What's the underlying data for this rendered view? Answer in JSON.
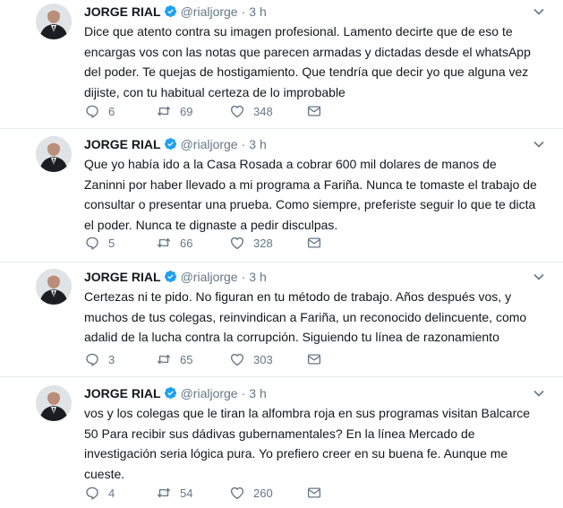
{
  "tweets": [
    {
      "name": "JORGE RIAL",
      "handle": "@rialjorge",
      "dot": "·",
      "time": "3 h",
      "text": "Dice que atento contra su imagen profesional. Lamento decirte que de eso te encargas vos con las notas que parecen armadas y dictadas desde el whatsApp del poder. Te quejas de hostigamiento. Que tendría que decir yo que alguna vez dijiste, con tu habitual certeza de lo improbable",
      "replies": "6",
      "retweets": "69",
      "likes": "348"
    },
    {
      "name": "JORGE RIAL",
      "handle": "@rialjorge",
      "dot": "·",
      "time": "3 h",
      "text": "Que yo había ido a la Casa Rosada a cobrar 600 mil dolares de manos de Zaninni por haber llevado a mi programa a Fariña. Nunca te tomaste el trabajo de consultar o presentar una prueba. Como siempre, preferiste seguir lo que te dicta el poder. Nunca te dignaste a pedir disculpas.",
      "replies": "5",
      "retweets": "66",
      "likes": "328"
    },
    {
      "name": "JORGE RIAL",
      "handle": "@rialjorge",
      "dot": "·",
      "time": "3 h",
      "text": "Certezas ni te pido. No figuran en tu método de trabajo. Años después vos, y muchos de tus colegas, reinvindican a Fariña, un reconocido delincuente, como adalid de la lucha contra la corrupción. Siguiendo tu línea de razonamiento",
      "replies": "3",
      "retweets": "65",
      "likes": "303"
    },
    {
      "name": "JORGE RIAL",
      "handle": "@rialjorge",
      "dot": "·",
      "time": "3 h",
      "text": "vos y los colegas que le tiran la alfombra  roja en sus programas visitan Balcarce 50  Para recibir sus dádivas gubernamentales? En la línea Mercado de investigación seria lógica pura. Yo prefiero creer en su buena fe. Aunque me cueste.",
      "replies": "4",
      "retweets": "54",
      "likes": "260"
    }
  ],
  "icons": {
    "avatar": "avatar-photo",
    "verified": "verified-badge-icon",
    "caret": "chevron-down-icon",
    "reply": "reply-icon",
    "retweet": "retweet-icon",
    "like": "heart-icon",
    "dm": "envelope-icon"
  },
  "colors": {
    "verified": "#1da1f2",
    "muted": "#657786",
    "text": "#14171a",
    "separator": "#e6ecf0"
  }
}
